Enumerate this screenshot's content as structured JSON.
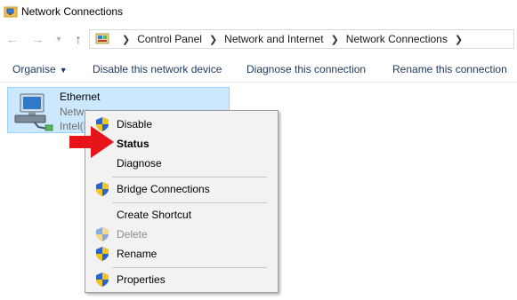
{
  "window": {
    "title": "Network Connections",
    "icon": "network-folder-icon"
  },
  "nav": {
    "back_icon": "back-arrow-icon",
    "forward_icon": "forward-arrow-icon",
    "recent_icon": "chevron-down-icon",
    "up_icon": "up-arrow-icon",
    "breadcrumbs": [
      "Control Panel",
      "Network and Internet",
      "Network Connections"
    ]
  },
  "commands": {
    "organise": "Organise",
    "disable": "Disable this network device",
    "diagnose": "Diagnose this connection",
    "rename": "Rename this connection"
  },
  "connection": {
    "name": "Ethernet",
    "status_partial": "Netwo",
    "device_partial": "Intel(I"
  },
  "context_menu": {
    "items": [
      {
        "label": "Disable",
        "shield": true,
        "bold": false,
        "enabled": true
      },
      {
        "label": "Status",
        "shield": false,
        "bold": true,
        "enabled": true
      },
      {
        "label": "Diagnose",
        "shield": false,
        "bold": false,
        "enabled": true
      },
      {
        "label": "Bridge Connections",
        "shield": true,
        "bold": false,
        "enabled": true
      },
      {
        "label": "Create Shortcut",
        "shield": false,
        "bold": false,
        "enabled": true
      },
      {
        "label": "Delete",
        "shield": true,
        "bold": false,
        "enabled": false
      },
      {
        "label": "Rename",
        "shield": true,
        "bold": false,
        "enabled": true
      },
      {
        "label": "Properties",
        "shield": true,
        "bold": false,
        "enabled": true
      }
    ]
  },
  "colors": {
    "selection": "#cce8ff",
    "command_text": "#1e395b",
    "arrow": "#e8141b"
  }
}
